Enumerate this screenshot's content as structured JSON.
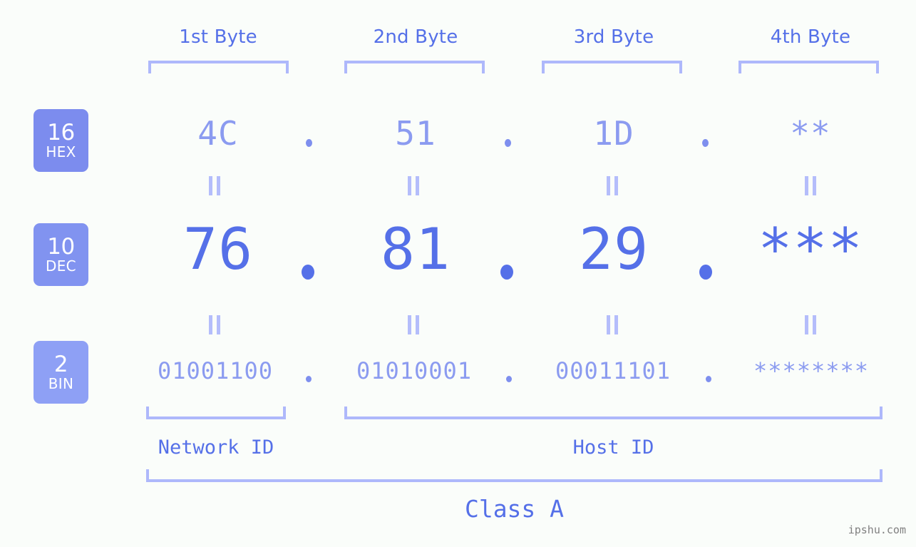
{
  "meta": {
    "background_color": "#fafdfa",
    "accent_color": "#5570e8",
    "light_accent_color": "#8b9bf0",
    "bracket_color": "#aeb8fb",
    "badge_color": "#7c8cee",
    "watermark": "ipshu.com"
  },
  "headers": [
    {
      "label": "1st Byte"
    },
    {
      "label": "2nd Byte"
    },
    {
      "label": "3rd Byte"
    },
    {
      "label": "4th Byte"
    }
  ],
  "bases": [
    {
      "num": "16",
      "label": "HEX"
    },
    {
      "num": "10",
      "label": "DEC"
    },
    {
      "num": "2",
      "label": "BIN"
    }
  ],
  "rows": {
    "hex": {
      "base_num": "16",
      "base_label": "HEX",
      "values": [
        "4C",
        "51",
        "1D",
        "**"
      ],
      "separator": "."
    },
    "dec": {
      "base_num": "10",
      "base_label": "DEC",
      "values": [
        "76",
        "81",
        "29",
        "***"
      ],
      "separator": "."
    },
    "bin": {
      "base_num": "2",
      "base_label": "BIN",
      "values": [
        "01001100",
        "01010001",
        "00011101",
        "********"
      ],
      "separator": "."
    }
  },
  "equals_marks": {
    "glyph": "||",
    "count_per_row": 4
  },
  "segments": [
    {
      "label": "Network ID"
    },
    {
      "label": "Host ID"
    }
  ],
  "class": {
    "label": "Class A"
  }
}
